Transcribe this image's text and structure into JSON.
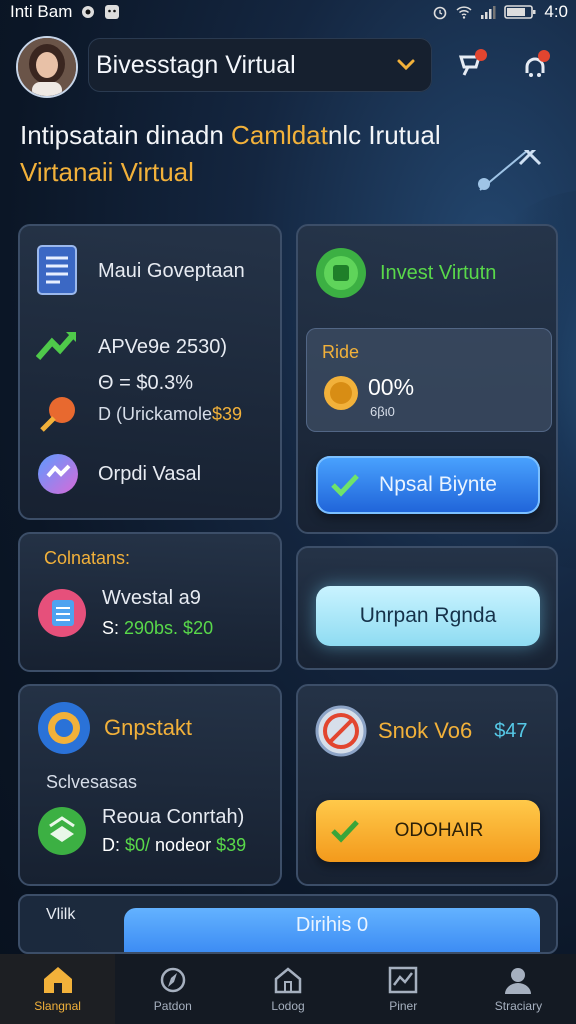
{
  "status_bar": {
    "carrier": "Inti Bam",
    "time": "4:0"
  },
  "header": {
    "account_label": "Bivesstagn Virtual",
    "avatar": "avatar-woman",
    "icons": [
      "chevron-down-icon",
      "notification-icon",
      "alert-icon"
    ]
  },
  "hero": {
    "line1_part1": "Intipsatain dinadn ",
    "line1_accent": "Camldat",
    "line1_part2": "nlc Irutual",
    "line2": "Virtanaii Virtual"
  },
  "card_portfolio": {
    "title": "Maui Goveptaan",
    "stat1": "APVe9e 2530)",
    "stat2": "Θ = $0.3%",
    "stat3_prefix": "D (Urickamole ",
    "stat3_value": "$39",
    "stat4": "Orpdi Vasal"
  },
  "card_invest": {
    "title": "Invest Virtutn",
    "panel_label": "Ride",
    "percent": "00%",
    "sublabel": "6βι0",
    "button": "Npsal Biynte"
  },
  "card_contacts": {
    "section": "Colnatans:",
    "title": "Wvestal a9",
    "line_prefix": "S: ",
    "line_value": "290bs. $20"
  },
  "card_unpan": {
    "button": "Unrpan Rgnda"
  },
  "card_gnpstakt": {
    "title": "Gnpstakt",
    "section": "Sclvesasas",
    "item_title": "Reoua Conrtah)",
    "line_prefix": "D: ",
    "line_green": "$0/",
    "line_mid": " nodeor ",
    "line_value": "$39"
  },
  "card_snok": {
    "title": "Snok Vo6",
    "amount": "$47",
    "button": "ODOHAIR"
  },
  "bottom_card": {
    "label": "Vlilk",
    "button": "Dirihis 0"
  },
  "nav": [
    {
      "label": "Slangnal",
      "icon": "home-icon"
    },
    {
      "label": "Patdon",
      "icon": "compass-icon"
    },
    {
      "label": "Lodog",
      "icon": "house-icon"
    },
    {
      "label": "Piner",
      "icon": "chart-icon"
    },
    {
      "label": "Straciary",
      "icon": "user-icon"
    }
  ],
  "colors": {
    "accent": "#f2b13a",
    "positive": "#59d94a",
    "primary": "#2f7ff0",
    "background": "#0f1b2c"
  }
}
